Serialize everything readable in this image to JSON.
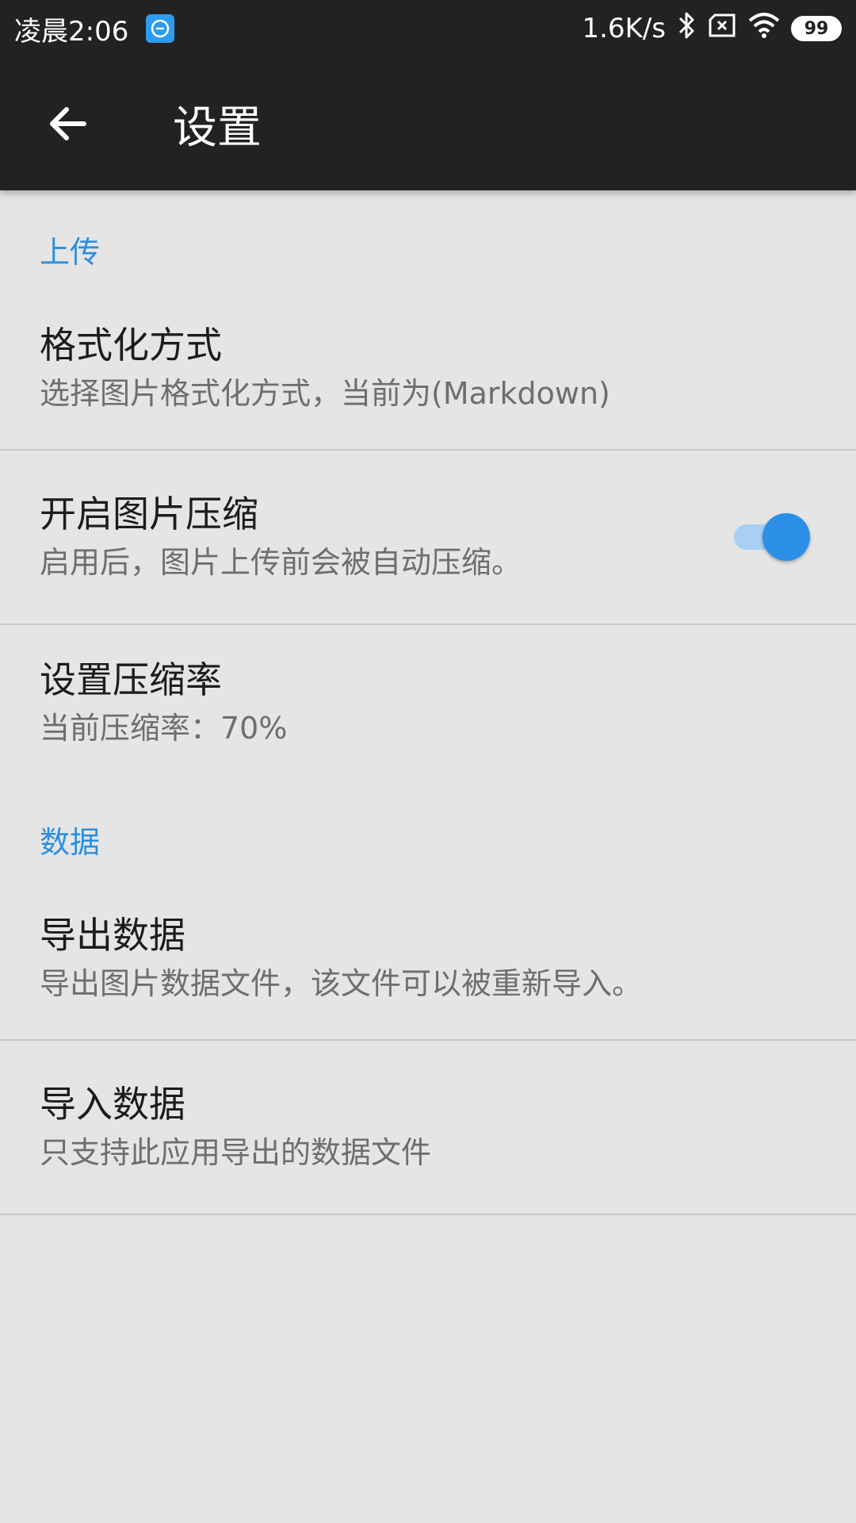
{
  "status_bar": {
    "time": "凌晨2:06",
    "network_speed": "1.6K/s",
    "battery_level": "99",
    "icons": [
      "app-notification-icon",
      "bluetooth-icon",
      "sim-icon",
      "wifi-icon",
      "battery-icon"
    ]
  },
  "app_bar": {
    "title": "设置",
    "back_icon": "arrow-left-icon"
  },
  "colors": {
    "accent": "#2b8fe0",
    "toolbar": "#222222",
    "background": "#e5e5e5",
    "switch_track": "#a9cff3",
    "switch_thumb": "#2b8fe8"
  },
  "sections": {
    "upload": {
      "header": "上传",
      "format": {
        "title": "格式化方式",
        "summary": "选择图片格式化方式，当前为(Markdown)"
      },
      "compress": {
        "title": "开启图片压缩",
        "summary": "启用后，图片上传前会被自动压缩。",
        "enabled": true
      },
      "ratio": {
        "title": "设置压缩率",
        "summary": "当前压缩率：70%"
      }
    },
    "data": {
      "header": "数据",
      "export": {
        "title": "导出数据",
        "summary": "导出图片数据文件，该文件可以被重新导入。"
      },
      "import": {
        "title": "导入数据",
        "summary": "只支持此应用导出的数据文件"
      }
    }
  }
}
